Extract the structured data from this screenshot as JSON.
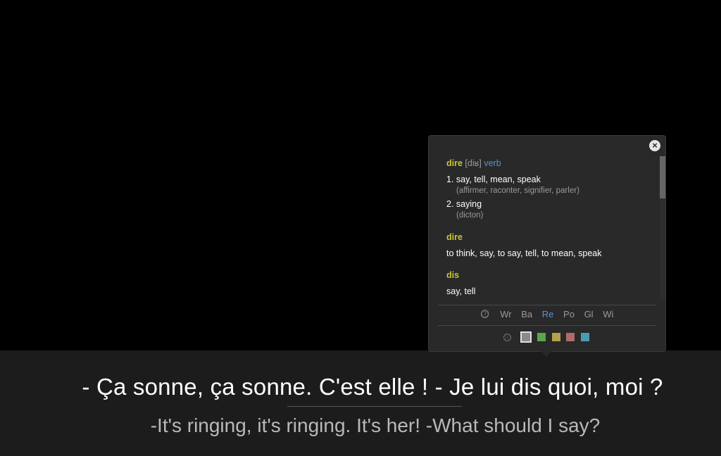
{
  "subtitles": {
    "original": "- Ça sonne, ça sonne. C'est elle ! - Je lui dis quoi, moi ?",
    "translation": "-It's ringing, it's ringing. It's her! -What should I say?"
  },
  "popup": {
    "close_label": "×",
    "entries": {
      "e1": {
        "word": "dire",
        "pronunciation": "[diʁ]",
        "pos": "verb",
        "senses": [
          {
            "text": "1. say, tell, mean, speak",
            "gloss": "(affirmer, raconter, signifier, parler)"
          },
          {
            "text": "2. saying",
            "gloss": "(dicton)"
          }
        ]
      },
      "e2": {
        "word": "dire",
        "definition": "to think, say, to say, tell, to mean, speak"
      },
      "e3": {
        "word": "dis",
        "definition": "say, tell"
      }
    },
    "sources": {
      "info_icon": "ⓘ",
      "items": [
        "Wr",
        "Ba",
        "Re",
        "Po",
        "Gl",
        "Wi"
      ],
      "active": "Re"
    },
    "colors": {
      "info_icon": "ⓘ",
      "swatches": [
        "#8a8a8a",
        "#5aa54a",
        "#b3a34a",
        "#b06a6a",
        "#4a9db0"
      ],
      "selected_index": 0
    }
  }
}
